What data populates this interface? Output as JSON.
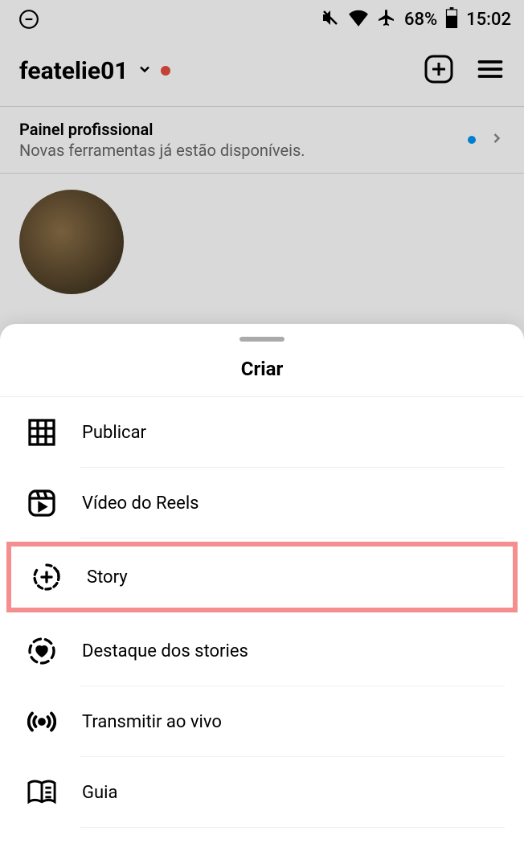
{
  "statusBar": {
    "battery": "68%",
    "time": "15:02"
  },
  "header": {
    "username": "featelie01"
  },
  "proPanel": {
    "title": "Painel profissional",
    "subtitle": "Novas ferramentas já estão disponíveis."
  },
  "sheet": {
    "title": "Criar",
    "items": [
      {
        "label": "Publicar"
      },
      {
        "label": "Vídeo do Reels"
      },
      {
        "label": "Story"
      },
      {
        "label": "Destaque dos stories"
      },
      {
        "label": "Transmitir ao vivo"
      },
      {
        "label": "Guia"
      }
    ]
  }
}
